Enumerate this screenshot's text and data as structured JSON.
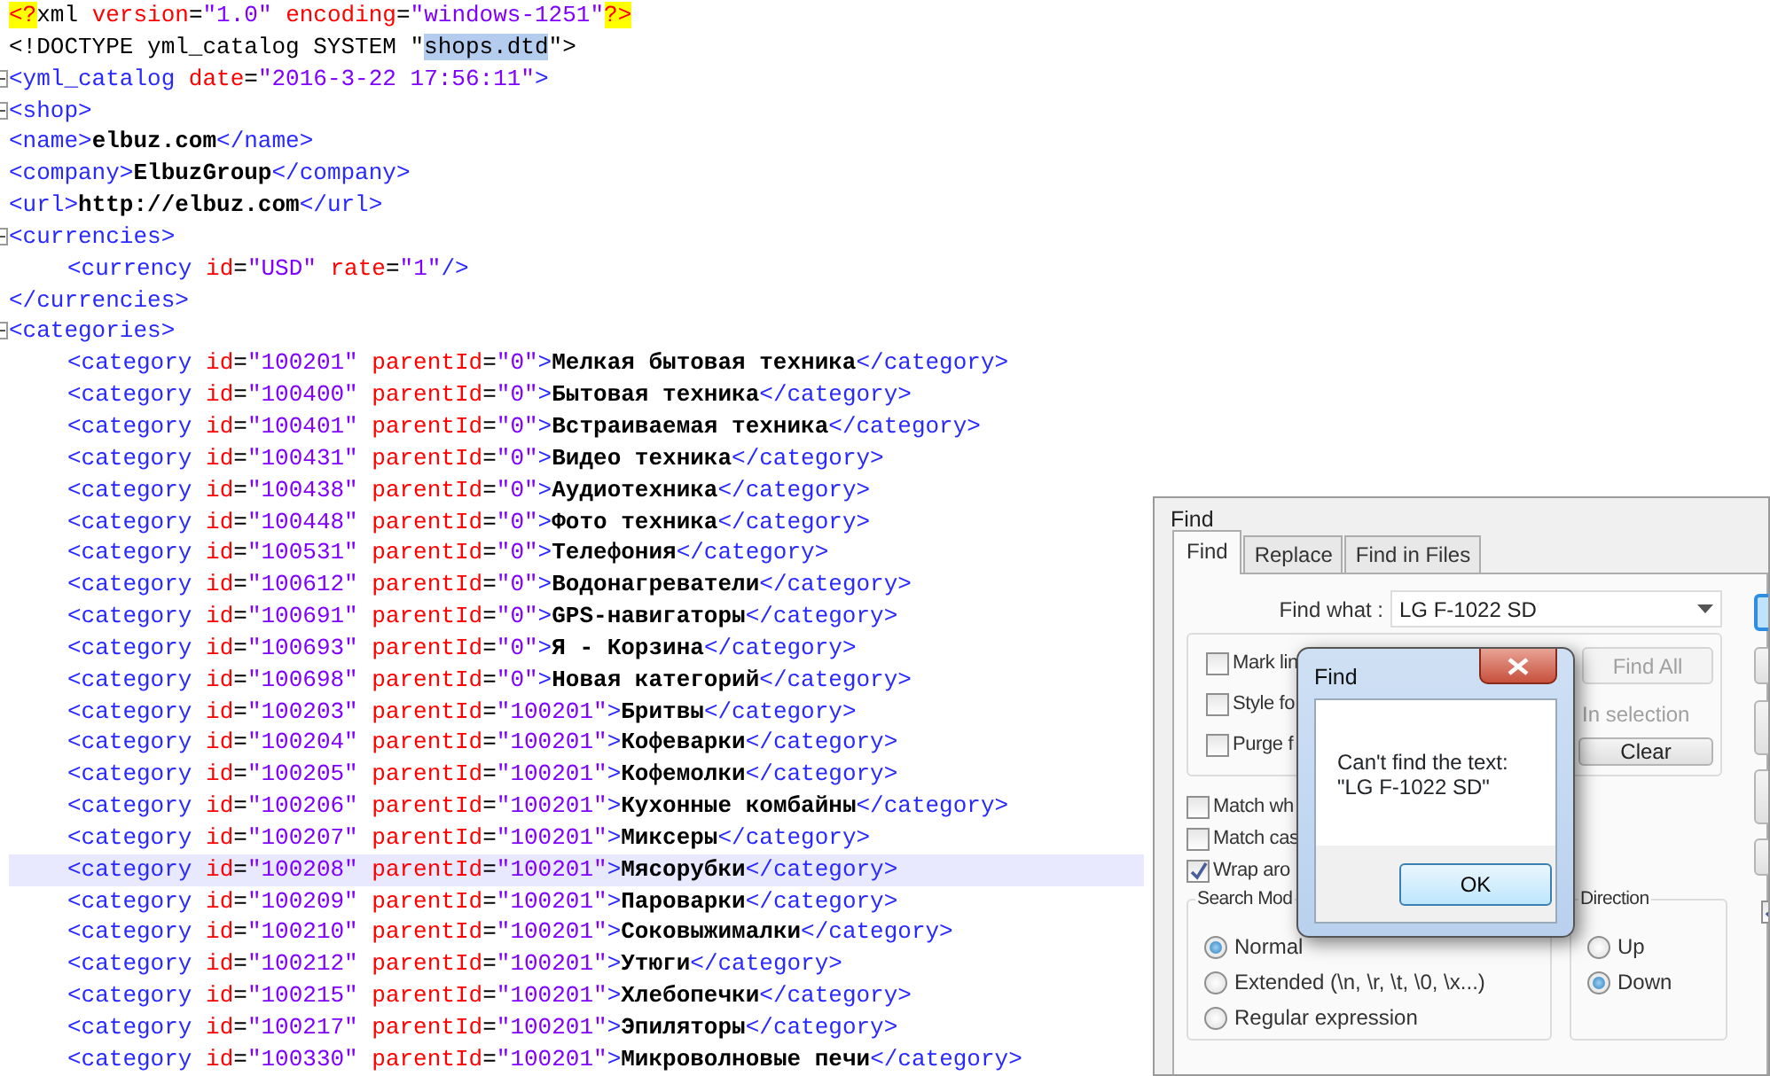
{
  "editor": {
    "lines": [
      {
        "fold": false,
        "current": false,
        "tokens": [
          {
            "kind": "pi",
            "text": "<?"
          },
          {
            "kind": "plain",
            "text": "xml "
          },
          {
            "kind": "attr",
            "text": "version"
          },
          {
            "kind": "eq",
            "text": "="
          },
          {
            "kind": "value",
            "text": "\"1.0\" "
          },
          {
            "kind": "attr",
            "text": "encoding"
          },
          {
            "kind": "eq",
            "text": "="
          },
          {
            "kind": "value",
            "text": "\"windows-1251\""
          },
          {
            "kind": "pi",
            "text": "?>"
          }
        ]
      },
      {
        "fold": false,
        "current": false,
        "tokens": [
          {
            "kind": "plain",
            "text": "<!DOCTYPE yml_catalog SYSTEM \""
          },
          {
            "kind": "selection",
            "text": "shops.dtd"
          },
          {
            "kind": "plain",
            "text": "\">"
          }
        ]
      },
      {
        "fold": true,
        "current": false,
        "tokens": [
          {
            "kind": "tag",
            "text": "<yml_catalog "
          },
          {
            "kind": "attr",
            "text": "date"
          },
          {
            "kind": "eq",
            "text": "="
          },
          {
            "kind": "value",
            "text": "\"2016-3-22 17:56:11\""
          },
          {
            "kind": "tag",
            "text": ">"
          }
        ]
      },
      {
        "fold": true,
        "current": false,
        "tokens": [
          {
            "kind": "tag",
            "text": "<shop>"
          }
        ]
      },
      {
        "fold": false,
        "current": false,
        "tokens": [
          {
            "kind": "tag",
            "text": "<name>"
          },
          {
            "kind": "text",
            "text": "elbuz.com"
          },
          {
            "kind": "tag",
            "text": "</name>"
          }
        ]
      },
      {
        "fold": false,
        "current": false,
        "tokens": [
          {
            "kind": "tag",
            "text": "<company>"
          },
          {
            "kind": "text",
            "text": "ElbuzGroup"
          },
          {
            "kind": "tag",
            "text": "</company>"
          }
        ]
      },
      {
        "fold": false,
        "current": false,
        "tokens": [
          {
            "kind": "tag",
            "text": "<url>"
          },
          {
            "kind": "text",
            "text": "http://elbuz.com"
          },
          {
            "kind": "tag",
            "text": "</url>"
          }
        ]
      },
      {
        "fold": true,
        "current": false,
        "tokens": [
          {
            "kind": "tag",
            "text": "<currencies>"
          }
        ],
        "children": [
          {
            "fold": false,
            "current": false,
            "tokens": [
              {
                "kind": "tag",
                "text": "<currency "
              },
              {
                "kind": "attr",
                "text": "id"
              },
              {
                "kind": "eq",
                "text": "="
              },
              {
                "kind": "value",
                "text": "\"USD\" "
              },
              {
                "kind": "attr",
                "text": "rate"
              },
              {
                "kind": "eq",
                "text": "="
              },
              {
                "kind": "value",
                "text": "\"1\""
              },
              {
                "kind": "tag",
                "text": "/>"
              }
            ]
          }
        ]
      },
      {
        "fold": false,
        "current": false,
        "tokens": [
          {
            "kind": "tag",
            "text": "</currencies>"
          }
        ]
      },
      {
        "fold": true,
        "current": false,
        "tokens": [
          {
            "kind": "tag",
            "text": "<categories>"
          }
        ],
        "children": [
          {
            "fold": false,
            "current": false,
            "tokens": [
              {
                "kind": "tag",
                "text": "<category "
              },
              {
                "kind": "attr",
                "text": "id"
              },
              {
                "kind": "eq",
                "text": "="
              },
              {
                "kind": "value",
                "text": "\"100201\" "
              },
              {
                "kind": "attr",
                "text": "parentId"
              },
              {
                "kind": "eq",
                "text": "="
              },
              {
                "kind": "value",
                "text": "\"0\""
              },
              {
                "kind": "tag",
                "text": ">"
              },
              {
                "kind": "text",
                "text": "Мелкая бытовая техника"
              },
              {
                "kind": "tag",
                "text": "</category>"
              }
            ]
          },
          {
            "fold": false,
            "current": false,
            "tokens": [
              {
                "kind": "tag",
                "text": "<category "
              },
              {
                "kind": "attr",
                "text": "id"
              },
              {
                "kind": "eq",
                "text": "="
              },
              {
                "kind": "value",
                "text": "\"100400\" "
              },
              {
                "kind": "attr",
                "text": "parentId"
              },
              {
                "kind": "eq",
                "text": "="
              },
              {
                "kind": "value",
                "text": "\"0\""
              },
              {
                "kind": "tag",
                "text": ">"
              },
              {
                "kind": "text",
                "text": "Бытовая техника"
              },
              {
                "kind": "tag",
                "text": "</category>"
              }
            ]
          },
          {
            "fold": false,
            "current": false,
            "tokens": [
              {
                "kind": "tag",
                "text": "<category "
              },
              {
                "kind": "attr",
                "text": "id"
              },
              {
                "kind": "eq",
                "text": "="
              },
              {
                "kind": "value",
                "text": "\"100401\" "
              },
              {
                "kind": "attr",
                "text": "parentId"
              },
              {
                "kind": "eq",
                "text": "="
              },
              {
                "kind": "value",
                "text": "\"0\""
              },
              {
                "kind": "tag",
                "text": ">"
              },
              {
                "kind": "text",
                "text": "Встраиваемая техника"
              },
              {
                "kind": "tag",
                "text": "</category>"
              }
            ]
          },
          {
            "fold": false,
            "current": false,
            "tokens": [
              {
                "kind": "tag",
                "text": "<category "
              },
              {
                "kind": "attr",
                "text": "id"
              },
              {
                "kind": "eq",
                "text": "="
              },
              {
                "kind": "value",
                "text": "\"100431\" "
              },
              {
                "kind": "attr",
                "text": "parentId"
              },
              {
                "kind": "eq",
                "text": "="
              },
              {
                "kind": "value",
                "text": "\"0\""
              },
              {
                "kind": "tag",
                "text": ">"
              },
              {
                "kind": "text",
                "text": "Видео техника"
              },
              {
                "kind": "tag",
                "text": "</category>"
              }
            ]
          },
          {
            "fold": false,
            "current": false,
            "tokens": [
              {
                "kind": "tag",
                "text": "<category "
              },
              {
                "kind": "attr",
                "text": "id"
              },
              {
                "kind": "eq",
                "text": "="
              },
              {
                "kind": "value",
                "text": "\"100438\" "
              },
              {
                "kind": "attr",
                "text": "parentId"
              },
              {
                "kind": "eq",
                "text": "="
              },
              {
                "kind": "value",
                "text": "\"0\""
              },
              {
                "kind": "tag",
                "text": ">"
              },
              {
                "kind": "text",
                "text": "Аудиотехника"
              },
              {
                "kind": "tag",
                "text": "</category>"
              }
            ]
          },
          {
            "fold": false,
            "current": false,
            "tokens": [
              {
                "kind": "tag",
                "text": "<category "
              },
              {
                "kind": "attr",
                "text": "id"
              },
              {
                "kind": "eq",
                "text": "="
              },
              {
                "kind": "value",
                "text": "\"100448\" "
              },
              {
                "kind": "attr",
                "text": "parentId"
              },
              {
                "kind": "eq",
                "text": "="
              },
              {
                "kind": "value",
                "text": "\"0\""
              },
              {
                "kind": "tag",
                "text": ">"
              },
              {
                "kind": "text",
                "text": "Фото техника"
              },
              {
                "kind": "tag",
                "text": "</category>"
              }
            ]
          },
          {
            "fold": false,
            "current": false,
            "tokens": [
              {
                "kind": "tag",
                "text": "<category "
              },
              {
                "kind": "attr",
                "text": "id"
              },
              {
                "kind": "eq",
                "text": "="
              },
              {
                "kind": "value",
                "text": "\"100531\" "
              },
              {
                "kind": "attr",
                "text": "parentId"
              },
              {
                "kind": "eq",
                "text": "="
              },
              {
                "kind": "value",
                "text": "\"0\""
              },
              {
                "kind": "tag",
                "text": ">"
              },
              {
                "kind": "text",
                "text": "Телефония"
              },
              {
                "kind": "tag",
                "text": "</category>"
              }
            ]
          },
          {
            "fold": false,
            "current": false,
            "tokens": [
              {
                "kind": "tag",
                "text": "<category "
              },
              {
                "kind": "attr",
                "text": "id"
              },
              {
                "kind": "eq",
                "text": "="
              },
              {
                "kind": "value",
                "text": "\"100612\" "
              },
              {
                "kind": "attr",
                "text": "parentId"
              },
              {
                "kind": "eq",
                "text": "="
              },
              {
                "kind": "value",
                "text": "\"0\""
              },
              {
                "kind": "tag",
                "text": ">"
              },
              {
                "kind": "text",
                "text": "Водонагреватели"
              },
              {
                "kind": "tag",
                "text": "</category>"
              }
            ]
          },
          {
            "fold": false,
            "current": false,
            "tokens": [
              {
                "kind": "tag",
                "text": "<category "
              },
              {
                "kind": "attr",
                "text": "id"
              },
              {
                "kind": "eq",
                "text": "="
              },
              {
                "kind": "value",
                "text": "\"100691\" "
              },
              {
                "kind": "attr",
                "text": "parentId"
              },
              {
                "kind": "eq",
                "text": "="
              },
              {
                "kind": "value",
                "text": "\"0\""
              },
              {
                "kind": "tag",
                "text": ">"
              },
              {
                "kind": "text",
                "text": "GPS-навигаторы"
              },
              {
                "kind": "tag",
                "text": "</category>"
              }
            ]
          },
          {
            "fold": false,
            "current": false,
            "tokens": [
              {
                "kind": "tag",
                "text": "<category "
              },
              {
                "kind": "attr",
                "text": "id"
              },
              {
                "kind": "eq",
                "text": "="
              },
              {
                "kind": "value",
                "text": "\"100693\" "
              },
              {
                "kind": "attr",
                "text": "parentId"
              },
              {
                "kind": "eq",
                "text": "="
              },
              {
                "kind": "value",
                "text": "\"0\""
              },
              {
                "kind": "tag",
                "text": ">"
              },
              {
                "kind": "text",
                "text": "Я - Корзина"
              },
              {
                "kind": "tag",
                "text": "</category>"
              }
            ]
          },
          {
            "fold": false,
            "current": false,
            "tokens": [
              {
                "kind": "tag",
                "text": "<category "
              },
              {
                "kind": "attr",
                "text": "id"
              },
              {
                "kind": "eq",
                "text": "="
              },
              {
                "kind": "value",
                "text": "\"100698\" "
              },
              {
                "kind": "attr",
                "text": "parentId"
              },
              {
                "kind": "eq",
                "text": "="
              },
              {
                "kind": "value",
                "text": "\"0\""
              },
              {
                "kind": "tag",
                "text": ">"
              },
              {
                "kind": "text",
                "text": "Новая категорий"
              },
              {
                "kind": "tag",
                "text": "</category>"
              }
            ]
          },
          {
            "fold": false,
            "current": false,
            "tokens": [
              {
                "kind": "tag",
                "text": "<category "
              },
              {
                "kind": "attr",
                "text": "id"
              },
              {
                "kind": "eq",
                "text": "="
              },
              {
                "kind": "value",
                "text": "\"100203\" "
              },
              {
                "kind": "attr",
                "text": "parentId"
              },
              {
                "kind": "eq",
                "text": "="
              },
              {
                "kind": "value",
                "text": "\"100201\""
              },
              {
                "kind": "tag",
                "text": ">"
              },
              {
                "kind": "text",
                "text": "Бритвы"
              },
              {
                "kind": "tag",
                "text": "</category>"
              }
            ]
          },
          {
            "fold": false,
            "current": false,
            "tokens": [
              {
                "kind": "tag",
                "text": "<category "
              },
              {
                "kind": "attr",
                "text": "id"
              },
              {
                "kind": "eq",
                "text": "="
              },
              {
                "kind": "value",
                "text": "\"100204\" "
              },
              {
                "kind": "attr",
                "text": "parentId"
              },
              {
                "kind": "eq",
                "text": "="
              },
              {
                "kind": "value",
                "text": "\"100201\""
              },
              {
                "kind": "tag",
                "text": ">"
              },
              {
                "kind": "text",
                "text": "Кофеварки"
              },
              {
                "kind": "tag",
                "text": "</category>"
              }
            ]
          },
          {
            "fold": false,
            "current": false,
            "tokens": [
              {
                "kind": "tag",
                "text": "<category "
              },
              {
                "kind": "attr",
                "text": "id"
              },
              {
                "kind": "eq",
                "text": "="
              },
              {
                "kind": "value",
                "text": "\"100205\" "
              },
              {
                "kind": "attr",
                "text": "parentId"
              },
              {
                "kind": "eq",
                "text": "="
              },
              {
                "kind": "value",
                "text": "\"100201\""
              },
              {
                "kind": "tag",
                "text": ">"
              },
              {
                "kind": "text",
                "text": "Кофемолки"
              },
              {
                "kind": "tag",
                "text": "</category>"
              }
            ]
          },
          {
            "fold": false,
            "current": false,
            "tokens": [
              {
                "kind": "tag",
                "text": "<category "
              },
              {
                "kind": "attr",
                "text": "id"
              },
              {
                "kind": "eq",
                "text": "="
              },
              {
                "kind": "value",
                "text": "\"100206\" "
              },
              {
                "kind": "attr",
                "text": "parentId"
              },
              {
                "kind": "eq",
                "text": "="
              },
              {
                "kind": "value",
                "text": "\"100201\""
              },
              {
                "kind": "tag",
                "text": ">"
              },
              {
                "kind": "text",
                "text": "Кухонные комбайны"
              },
              {
                "kind": "tag",
                "text": "</category>"
              }
            ]
          },
          {
            "fold": false,
            "current": false,
            "tokens": [
              {
                "kind": "tag",
                "text": "<category "
              },
              {
                "kind": "attr",
                "text": "id"
              },
              {
                "kind": "eq",
                "text": "="
              },
              {
                "kind": "value",
                "text": "\"100207\" "
              },
              {
                "kind": "attr",
                "text": "parentId"
              },
              {
                "kind": "eq",
                "text": "="
              },
              {
                "kind": "value",
                "text": "\"100201\""
              },
              {
                "kind": "tag",
                "text": ">"
              },
              {
                "kind": "text",
                "text": "Миксеры"
              },
              {
                "kind": "tag",
                "text": "</category>"
              }
            ]
          },
          {
            "fold": false,
            "current": true,
            "tokens": [
              {
                "kind": "tag",
                "text": "<category "
              },
              {
                "kind": "attr",
                "text": "id"
              },
              {
                "kind": "eq",
                "text": "="
              },
              {
                "kind": "value",
                "text": "\"100208\" "
              },
              {
                "kind": "attr",
                "text": "parentId"
              },
              {
                "kind": "eq",
                "text": "="
              },
              {
                "kind": "value",
                "text": "\"100201\""
              },
              {
                "kind": "tag",
                "text": ">"
              },
              {
                "kind": "text",
                "text": "Мясорубки"
              },
              {
                "kind": "tag",
                "text": "</category>"
              }
            ]
          },
          {
            "fold": false,
            "current": false,
            "tokens": [
              {
                "kind": "tag",
                "text": "<category "
              },
              {
                "kind": "attr",
                "text": "id"
              },
              {
                "kind": "eq",
                "text": "="
              },
              {
                "kind": "value",
                "text": "\"100209\" "
              },
              {
                "kind": "attr",
                "text": "parentId"
              },
              {
                "kind": "eq",
                "text": "="
              },
              {
                "kind": "value",
                "text": "\"100201\""
              },
              {
                "kind": "tag",
                "text": ">"
              },
              {
                "kind": "text",
                "text": "Пароварки"
              },
              {
                "kind": "tag",
                "text": "</category>"
              }
            ]
          },
          {
            "fold": false,
            "current": false,
            "tokens": [
              {
                "kind": "tag",
                "text": "<category "
              },
              {
                "kind": "attr",
                "text": "id"
              },
              {
                "kind": "eq",
                "text": "="
              },
              {
                "kind": "value",
                "text": "\"100210\" "
              },
              {
                "kind": "attr",
                "text": "parentId"
              },
              {
                "kind": "eq",
                "text": "="
              },
              {
                "kind": "value",
                "text": "\"100201\""
              },
              {
                "kind": "tag",
                "text": ">"
              },
              {
                "kind": "text",
                "text": "Соковыжималки"
              },
              {
                "kind": "tag",
                "text": "</category>"
              }
            ]
          },
          {
            "fold": false,
            "current": false,
            "tokens": [
              {
                "kind": "tag",
                "text": "<category "
              },
              {
                "kind": "attr",
                "text": "id"
              },
              {
                "kind": "eq",
                "text": "="
              },
              {
                "kind": "value",
                "text": "\"100212\" "
              },
              {
                "kind": "attr",
                "text": "parentId"
              },
              {
                "kind": "eq",
                "text": "="
              },
              {
                "kind": "value",
                "text": "\"100201\""
              },
              {
                "kind": "tag",
                "text": ">"
              },
              {
                "kind": "text",
                "text": "Утюги"
              },
              {
                "kind": "tag",
                "text": "</category>"
              }
            ]
          },
          {
            "fold": false,
            "current": false,
            "tokens": [
              {
                "kind": "tag",
                "text": "<category "
              },
              {
                "kind": "attr",
                "text": "id"
              },
              {
                "kind": "eq",
                "text": "="
              },
              {
                "kind": "value",
                "text": "\"100215\" "
              },
              {
                "kind": "attr",
                "text": "parentId"
              },
              {
                "kind": "eq",
                "text": "="
              },
              {
                "kind": "value",
                "text": "\"100201\""
              },
              {
                "kind": "tag",
                "text": ">"
              },
              {
                "kind": "text",
                "text": "Хлебопечки"
              },
              {
                "kind": "tag",
                "text": "</category>"
              }
            ]
          },
          {
            "fold": false,
            "current": false,
            "tokens": [
              {
                "kind": "tag",
                "text": "<category "
              },
              {
                "kind": "attr",
                "text": "id"
              },
              {
                "kind": "eq",
                "text": "="
              },
              {
                "kind": "value",
                "text": "\"100217\" "
              },
              {
                "kind": "attr",
                "text": "parentId"
              },
              {
                "kind": "eq",
                "text": "="
              },
              {
                "kind": "value",
                "text": "\"100201\""
              },
              {
                "kind": "tag",
                "text": ">"
              },
              {
                "kind": "text",
                "text": "Эпиляторы"
              },
              {
                "kind": "tag",
                "text": "</category>"
              }
            ]
          },
          {
            "fold": false,
            "current": false,
            "tokens": [
              {
                "kind": "tag",
                "text": "<category "
              },
              {
                "kind": "attr",
                "text": "id"
              },
              {
                "kind": "eq",
                "text": "="
              },
              {
                "kind": "value",
                "text": "\"100330\" "
              },
              {
                "kind": "attr",
                "text": "parentId"
              },
              {
                "kind": "eq",
                "text": "="
              },
              {
                "kind": "value",
                "text": "\"100201\""
              },
              {
                "kind": "tag",
                "text": ">"
              },
              {
                "kind": "text",
                "text": "Микроволновые печи"
              },
              {
                "kind": "tag",
                "text": "</category>"
              }
            ]
          }
        ]
      }
    ]
  },
  "find_dialog": {
    "title": "Find",
    "tabs": [
      {
        "label": "Find",
        "selected": true
      },
      {
        "label": "Replace",
        "selected": false
      },
      {
        "label": "Find in Files",
        "selected": false
      }
    ],
    "find_what": {
      "label": "Find what :",
      "value": "LG F-1022 SD"
    },
    "mark_options": [
      {
        "label": "Mark lin",
        "checked": false
      },
      {
        "label": "Style fo",
        "checked": false
      },
      {
        "label": "Purge f",
        "checked": false
      }
    ],
    "find_all_button": {
      "label": "Find All",
      "disabled": true
    },
    "in_selection": {
      "label": "In selection",
      "disabled": true
    },
    "clear_button": {
      "label": "Clear",
      "disabled": false
    },
    "options": [
      {
        "label": "Match wh",
        "checked": false
      },
      {
        "label": "Match cas",
        "checked": false
      },
      {
        "label": "Wrap aro",
        "checked": true
      }
    ],
    "search_mode": {
      "legend": "Search Mod",
      "options": [
        {
          "label": "Normal",
          "selected": true
        },
        {
          "label": "Extended (\\n, \\r, \\t, \\0, \\x...)",
          "selected": false
        },
        {
          "label": "Regular expression",
          "selected": false
        }
      ]
    },
    "direction": {
      "legend": "Direction",
      "options": [
        {
          "label": "Up",
          "selected": false
        },
        {
          "label": "Down",
          "selected": true
        }
      ]
    },
    "side_controls": [
      {
        "kind": "button",
        "focused": true
      },
      {
        "kind": "button",
        "focused": false
      },
      {
        "kind": "tall_button",
        "focused": false
      },
      {
        "kind": "tall_button",
        "focused": false
      },
      {
        "kind": "button",
        "focused": false
      },
      {
        "kind": "checkbox",
        "checked": true
      }
    ]
  },
  "message_box": {
    "title": "Find",
    "message": "Can't find the text:\n\"LG F-1022 SD\"",
    "button": "OK"
  }
}
